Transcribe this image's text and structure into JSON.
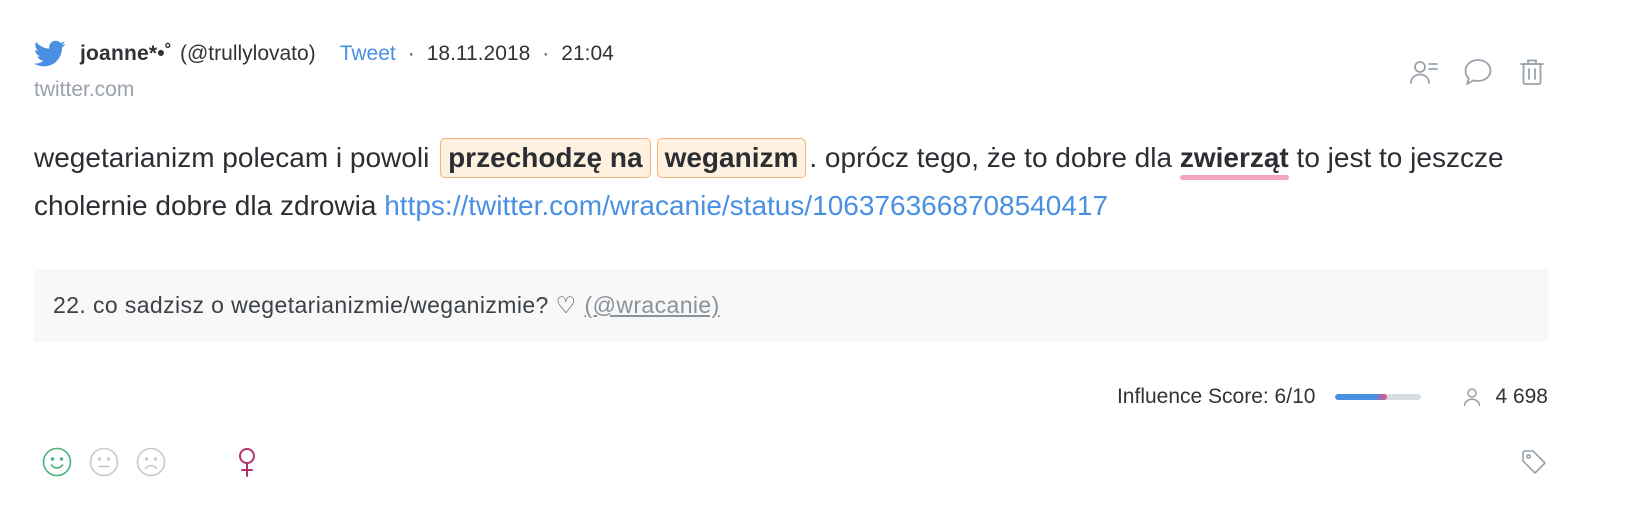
{
  "mention": {
    "author": "joanne*•˚",
    "handle": "(@trullylovato)",
    "type": "Tweet",
    "separator": "·",
    "date": "18.11.2018",
    "time": "21:04",
    "source": "twitter.com",
    "content": {
      "part1": "wegetarianizm polecam i powoli ",
      "highlight1": "przechodzę na",
      "highlight2": "weganizm",
      "part2": ". oprócz tego, że to dobre dla ",
      "underlined": "zwierząt",
      "part3": " to jest to jeszcze cholernie dobre dla zdrowia ",
      "link": "https://twitter.com/wracanie/status/1063763668708540417"
    },
    "quote": {
      "text": "22. co sadzisz o wegetarianizmie/weganizmie? ♡",
      "author": "(@wracanie)"
    },
    "influence": {
      "label": "Influence Score: 6/10",
      "score": 6,
      "max": 10
    },
    "reach": "4 698"
  },
  "icons": {
    "brand": "twitter-bird-icon",
    "actions": [
      "user-list-icon",
      "comment-icon",
      "trash-icon"
    ],
    "sentiment": [
      "smile-icon",
      "neutral-face-icon",
      "sad-face-icon"
    ],
    "gender": "female-icon",
    "reach": "user-icon",
    "tag": "tag-icon"
  },
  "colors": {
    "twitter_blue": "#4a90e2",
    "positive": "#4caf7d",
    "neutral": "#c4c9ce",
    "female": "#b3326b",
    "highlight_bg": "#fff1df",
    "highlight_border": "#f5b27a",
    "underline": "#f3a7bd"
  }
}
